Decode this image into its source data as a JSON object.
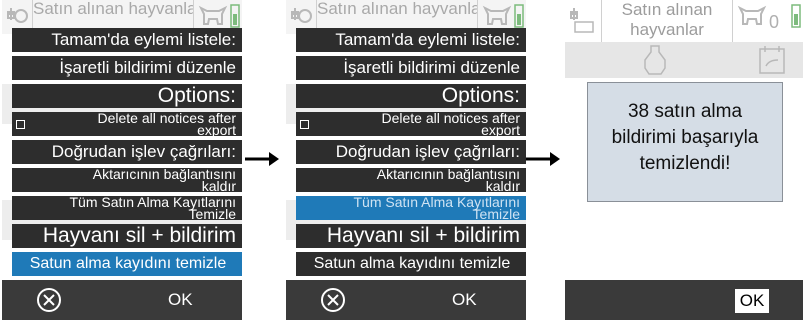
{
  "background": {
    "header_title": "Satın alınan hayvanlar",
    "badge_count": "0"
  },
  "menu_labels": {
    "list_on_ok": "Tamam'da eylemi listele:",
    "edit_marked": "İşaretli bildirimi düzenle",
    "options": "Options:",
    "delete_notices_line1": "Delete all notices after",
    "delete_notices_line2": "export",
    "direct_calls": "Doğrudan işlev çağrıları:",
    "disconnect_line1": "Aktarıcının bağlantısını",
    "disconnect_line2": "kaldır",
    "clear_all_line1": "Tüm Satın Alma Kayıtlarını",
    "clear_all_line2": "Temizle",
    "delete_animal": "Hayvanı sil + bildirim",
    "clear_purchase": "Satun alma kayıdını temizle"
  },
  "footer": {
    "ok_label": "OK"
  },
  "result_dialog": {
    "line1": "38 satın alma",
    "line2": "bildirimi başarıyla",
    "line3": "temizlendi!",
    "ok_label": "OK"
  },
  "colors": {
    "menu_item": "#2d2d2d",
    "selected": "#1f7ab8",
    "footer": "#3a3a3a",
    "dialog": "#d5dde6"
  }
}
